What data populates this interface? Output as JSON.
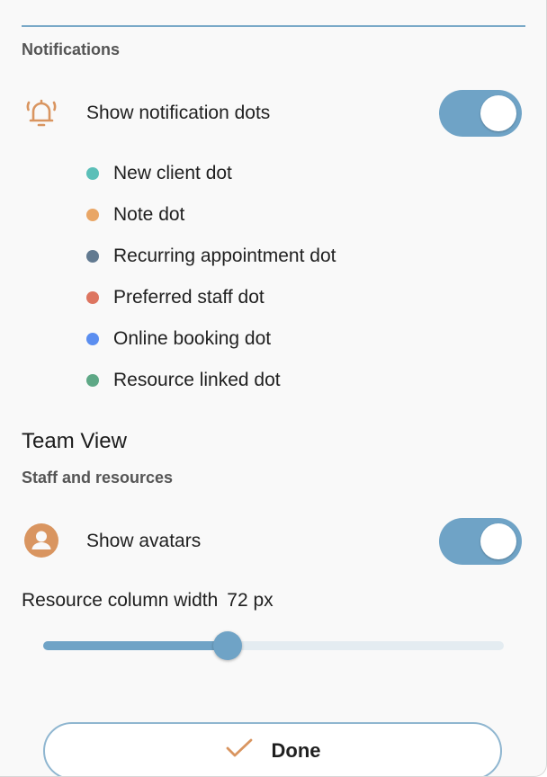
{
  "notifications": {
    "section_label": "Notifications",
    "show_dots": {
      "label": "Show notification dots",
      "icon": "bell-icon",
      "on": true
    },
    "dots": [
      {
        "label": "New client dot",
        "color": "#5bbfb8"
      },
      {
        "label": "Note dot",
        "color": "#e9a666"
      },
      {
        "label": "Recurring appointment dot",
        "color": "#627a91"
      },
      {
        "label": "Preferred staff dot",
        "color": "#dd7560"
      },
      {
        "label": "Online booking dot",
        "color": "#5b8ef0"
      },
      {
        "label": "Resource linked dot",
        "color": "#5ea886"
      }
    ]
  },
  "team_view": {
    "heading": "Team View",
    "section_label": "Staff and resources",
    "show_avatars": {
      "label": "Show avatars",
      "icon": "avatar-icon",
      "on": true
    },
    "column_width": {
      "label": "Resource column width",
      "value_text": "72 px",
      "fraction": 0.4
    }
  },
  "done_button": {
    "label": "Done",
    "icon": "check-icon"
  },
  "colors": {
    "accent": "#6fa3c6",
    "icon_orange": "#d99560",
    "divider": "#7aa9c8"
  }
}
